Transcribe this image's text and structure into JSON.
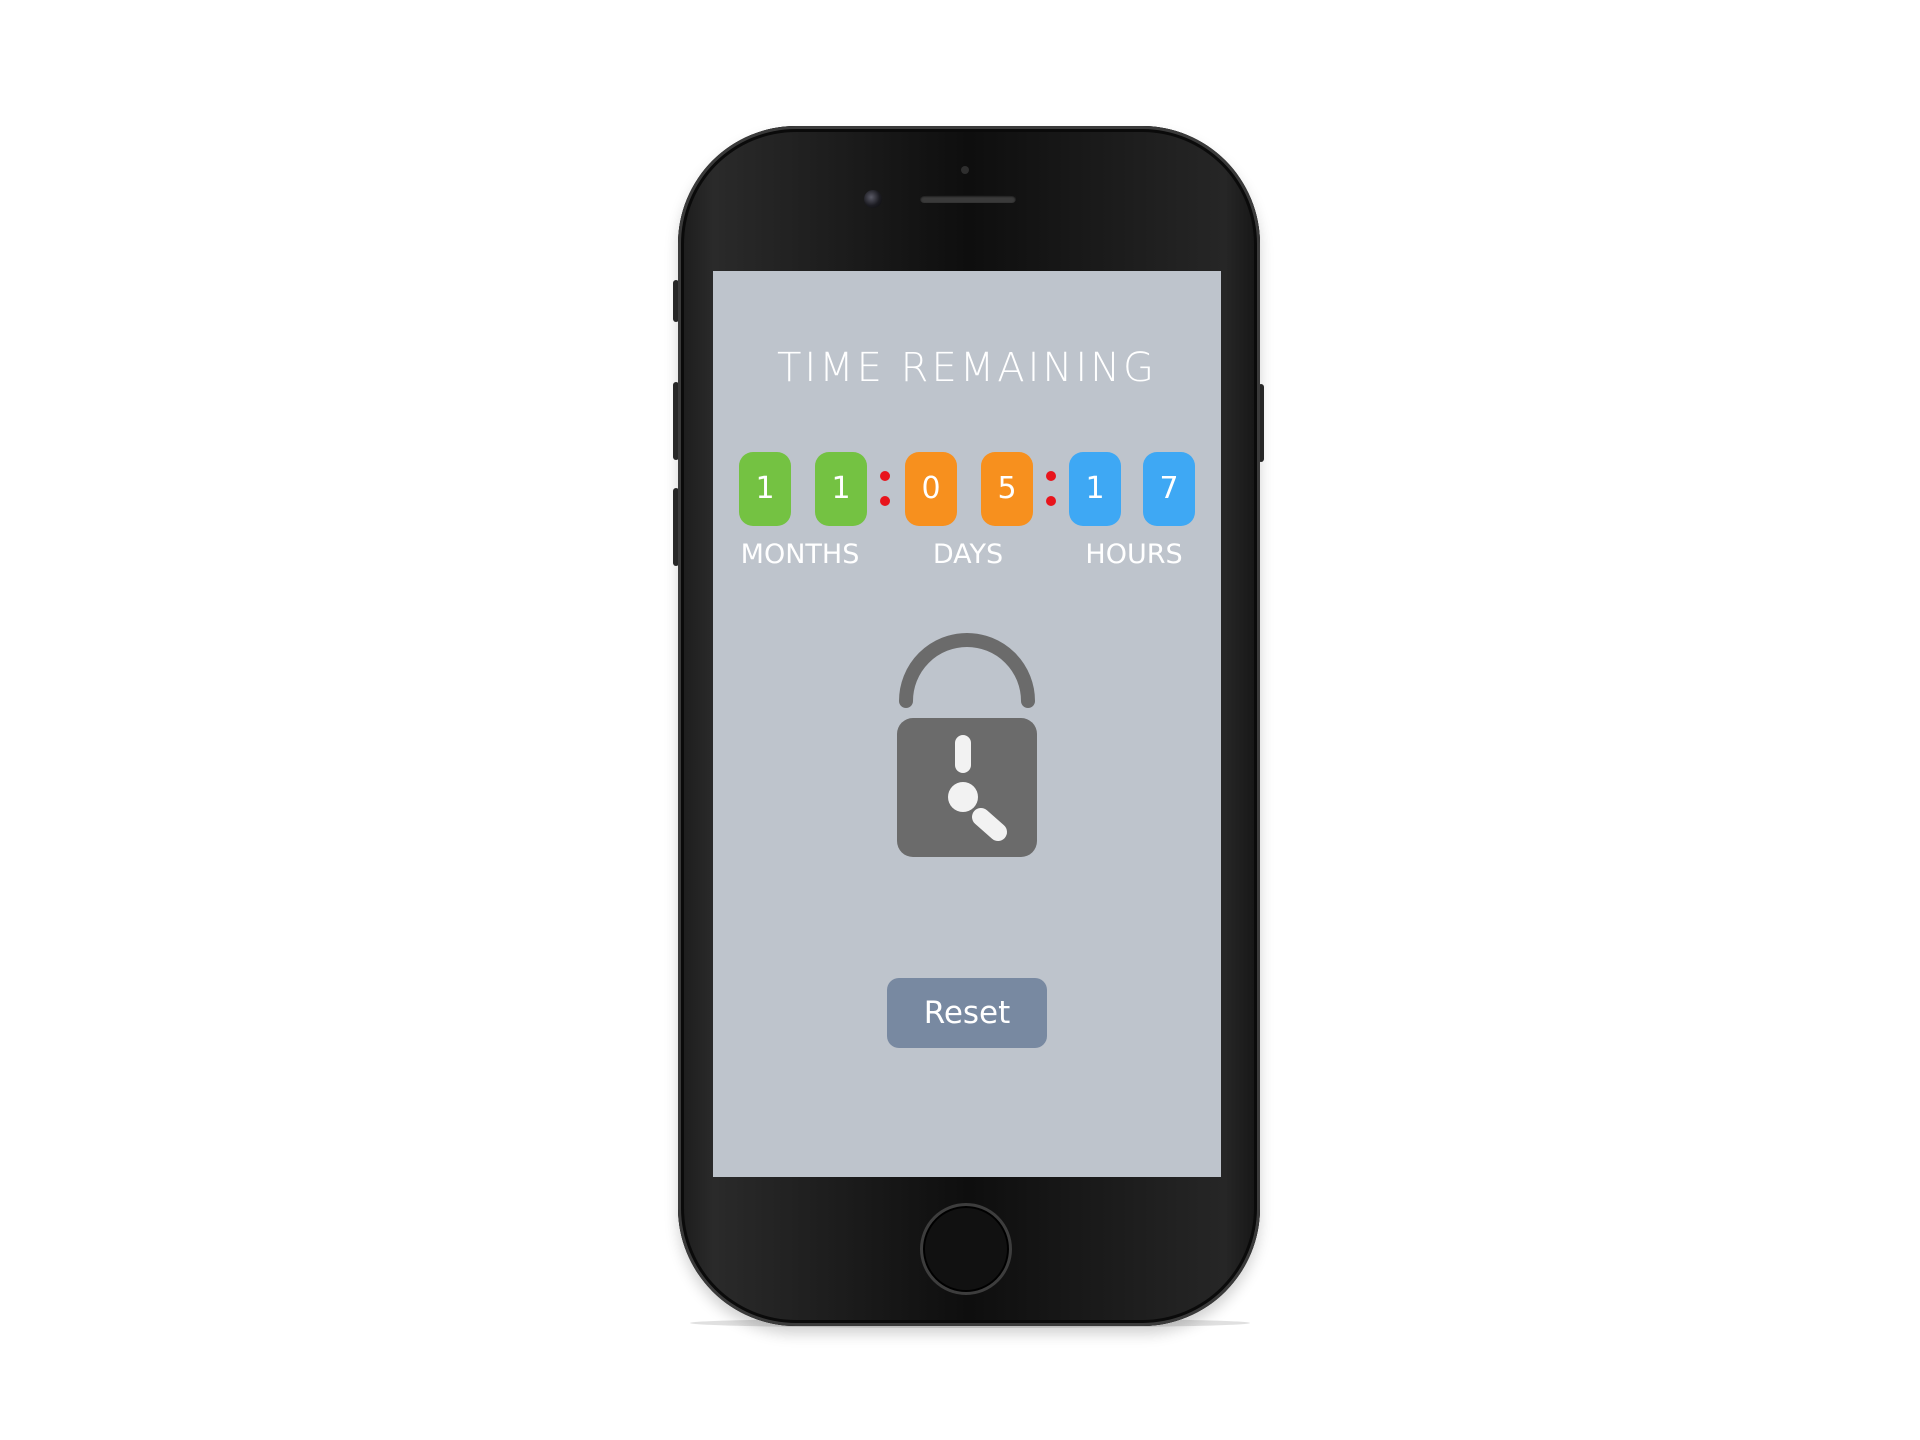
{
  "screen": {
    "title": "TIME REMAINING",
    "countdown": {
      "months": {
        "digits": [
          "1",
          "1"
        ],
        "label": "MONTHS",
        "color": "#74c242"
      },
      "days": {
        "digits": [
          "0",
          "5"
        ],
        "label": "DAYS",
        "color": "#f7901e"
      },
      "hours": {
        "digits": [
          "1",
          "7"
        ],
        "label": "HOURS",
        "color": "#3ea8f4"
      },
      "separator_color": "#e8141c"
    },
    "icon": "padlock-clock-icon",
    "reset_label": "Reset",
    "colors": {
      "screen_background": "#bec4cc",
      "button_background": "#7889a1",
      "icon_color": "#6b6b6b"
    }
  }
}
